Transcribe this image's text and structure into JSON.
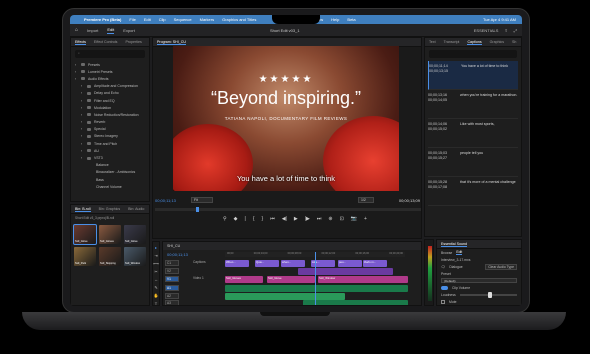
{
  "menubar": {
    "apple": "",
    "app": "Premiere Pro (Beta)",
    "items": [
      "File",
      "Edit",
      "Clip",
      "Sequence",
      "Markers",
      "Graphics and Titles",
      "View",
      "Window",
      "Help",
      "Beta"
    ],
    "clock": "Tue Apr 4  9:41 AM"
  },
  "app_header": {
    "home": "⌂",
    "import": "Import",
    "edit": "Edit",
    "export": "Export",
    "title": "Short Edit v03_1",
    "workspace": "ESSENTIALS"
  },
  "effects_panel": {
    "tabs": [
      "Effects",
      "Effect Controls",
      "Properties"
    ],
    "tree": [
      {
        "label": "Presets",
        "level": 0
      },
      {
        "label": "Lumetri Presets",
        "level": 0
      },
      {
        "label": "Audio Effects",
        "level": 0
      },
      {
        "label": "Amplitude and Compression",
        "level": 1
      },
      {
        "label": "Delay and Echo",
        "level": 1
      },
      {
        "label": "Filter and EQ",
        "level": 1
      },
      {
        "label": "Modulation",
        "level": 1
      },
      {
        "label": "Noise Reduction/Restoration",
        "level": 1
      },
      {
        "label": "Reverb",
        "level": 1
      },
      {
        "label": "Special",
        "level": 1
      },
      {
        "label": "Stereo Imagery",
        "level": 1
      },
      {
        "label": "Time and Pitch",
        "level": 1
      },
      {
        "label": "AU",
        "level": 1
      },
      {
        "label": "VST3",
        "level": 1
      },
      {
        "label": "Balance",
        "level": 2
      },
      {
        "label": "Binauralizer - Ambisonics",
        "level": 2
      },
      {
        "label": "Bass",
        "level": 2
      },
      {
        "label": "Channel Volume",
        "level": 2
      }
    ]
  },
  "program": {
    "title": "Program: SHI_CU",
    "rating": "★★★★★",
    "quote": "“Beyond inspiring.”",
    "byline": "TATIANA NAPOLI, DOCUMENTARY FILM REVIEWS",
    "caption": "You have a lot of time to think",
    "tc_left": "00;00;11;13",
    "fit": "Fit",
    "half": "1/2",
    "tc_right": "00;00;13;09",
    "transport": [
      "⚲",
      "◆",
      "|",
      "{",
      "}",
      "⏮",
      "◀|",
      "▶",
      "|▶",
      "⏭",
      "⊕",
      "⊡",
      "📷",
      "+"
    ]
  },
  "captions_panel": {
    "tabs": [
      "Text",
      "Transcript",
      "Captions",
      "Graphics",
      "Sh"
    ],
    "items": [
      {
        "tc_in": "00;00;11;14",
        "tc_out": "00;00;13;15",
        "text": "You have a lot of time to think"
      },
      {
        "tc_in": "00;00;13;16",
        "tc_out": "00;00;14;05",
        "text": "when you're training for a marathon."
      },
      {
        "tc_in": "00;00;14;06",
        "tc_out": "00;00;15;02",
        "text": "Like with most sports,"
      },
      {
        "tc_in": "00;00;15;03",
        "tc_out": "00;00;15;27",
        "text": "people tell you"
      },
      {
        "tc_in": "00;00;15;28",
        "tc_out": "00;00;17;08",
        "text": "that it's more of a mental challenge"
      }
    ]
  },
  "bin": {
    "tabs": [
      "Bin: B-roll",
      "Bin: Graphics",
      "Bin: Audio"
    ],
    "path": "Short Edit v3_3.prproj/B-roll",
    "thumbs": [
      {
        "label": "SHI_Glove",
        "color": "#6a3a30"
      },
      {
        "label": "SHI_Gloves",
        "color": "#8a5a40"
      },
      {
        "label": "SHI_Glove",
        "color": "#3a3a4a"
      },
      {
        "label": "SHI_Park",
        "color": "#8a6a3a"
      },
      {
        "label": "SHI_Skipping",
        "color": "#5a3a2a"
      },
      {
        "label": "SHI_Window",
        "color": "#4a5a6a"
      }
    ]
  },
  "tools": [
    "▸",
    "⇥",
    "⟷",
    "✂",
    "↔",
    "✎",
    "✋",
    "T"
  ],
  "timeline": {
    "title": "SHI_CU",
    "tc": "00;00;11;13",
    "ruler": [
      "00;00",
      "00;00;04;00",
      "00;00;08;00",
      "00;00;12;00",
      "00;00;16;00",
      "00;00;20;00"
    ],
    "tracks": [
      {
        "id": "C1",
        "name": "Captions"
      },
      {
        "id": "V2",
        "name": ""
      },
      {
        "id": "V1",
        "name": "Video 1"
      },
      {
        "id": "A1",
        "name": ""
      },
      {
        "id": "A2",
        "name": ""
      },
      {
        "id": "A3",
        "name": ""
      }
    ],
    "caption_clips": [
      "When...",
      "Quie...",
      "when...",
      "Like...",
      "peo...",
      "that's m..."
    ],
    "video_labels": [
      "SHI_Gloves",
      "SHI_Glove",
      "SHI_Window"
    ]
  },
  "essential_sound": {
    "title": "Essential Sound",
    "tabs": [
      "Browse",
      "Edit"
    ],
    "clip": "Interview_3-17.mxs",
    "type_label": "Dialogue",
    "clear_btn": "Clear Audio Type",
    "preset_label": "Preset",
    "preset_value": "(Default)",
    "clip_volume": "Clip Volume",
    "loudness": "Loudness",
    "mute": "Mute"
  }
}
